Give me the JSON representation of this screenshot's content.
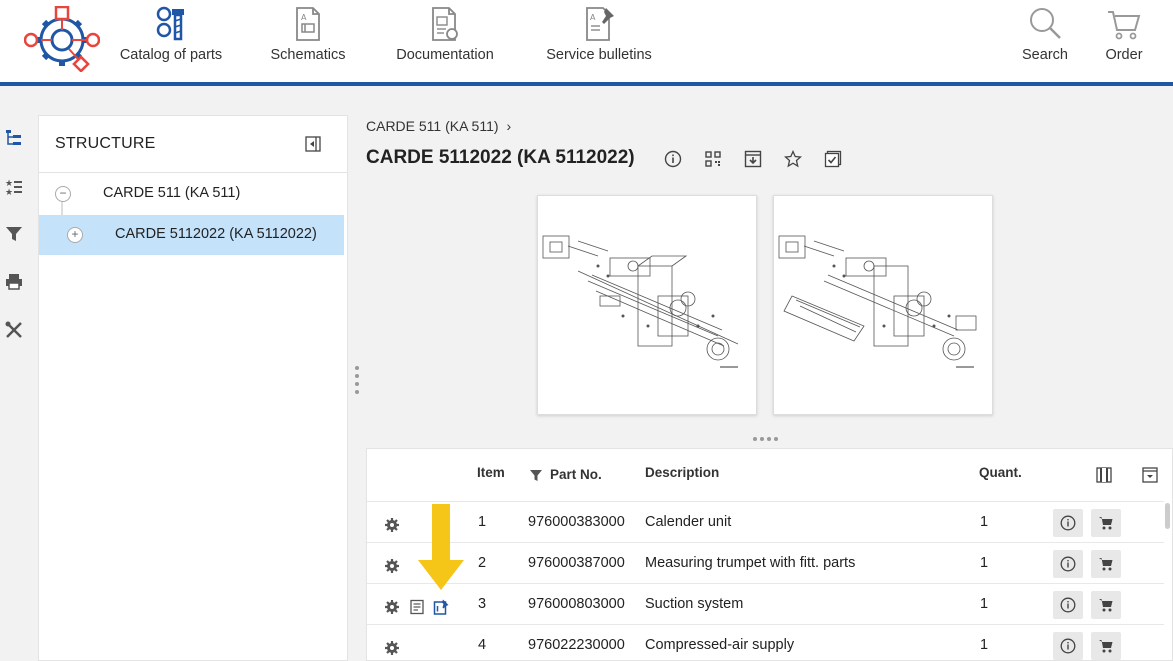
{
  "nav": {
    "catalog": "Catalog of parts",
    "schematics": "Schematics",
    "documentation": "Documentation",
    "bulletins": "Service bulletins",
    "search": "Search",
    "order": "Order"
  },
  "structure": {
    "title": "STRUCTURE",
    "tree": [
      {
        "label": "CARDE 511 (KA 511)",
        "toggle": "−"
      },
      {
        "label": "CARDE 5112022 (KA 5112022)",
        "toggle": "+"
      }
    ]
  },
  "main": {
    "breadcrumb": "CARDE 511 (KA 511)",
    "breadcrumb_sep": "›",
    "title": "CARDE 5112022 (KA 5112022)"
  },
  "table": {
    "headers": {
      "item": "Item",
      "part_no": "Part No.",
      "description": "Description",
      "quant": "Quant."
    },
    "rows": [
      {
        "item": "1",
        "part_no": "976000383000",
        "description": "Calender unit",
        "quant": "1"
      },
      {
        "item": "2",
        "part_no": "976000387000",
        "description": "Measuring trumpet with fitt. parts",
        "quant": "1"
      },
      {
        "item": "3",
        "part_no": "976000803000",
        "description": "Suction system",
        "quant": "1"
      },
      {
        "item": "4",
        "part_no": "976022230000",
        "description": "Compressed-air supply",
        "quant": "1"
      }
    ]
  },
  "colors": {
    "accent": "#1f56a5",
    "logo": "#e8453c",
    "selected": "#c4e2fa",
    "arrow": "#f5c518"
  }
}
